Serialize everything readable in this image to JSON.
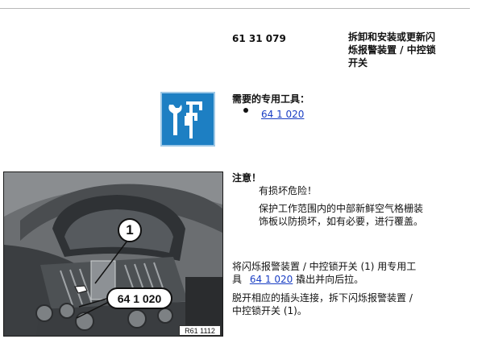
{
  "header": {
    "repair_number": "61 31 079",
    "title_lines": [
      "拆卸和安装或更新闪",
      "烁报警装置 / 中控锁",
      "开关"
    ]
  },
  "tools": {
    "heading": "需要的专用工具：",
    "items": [
      {
        "code": "64 1 020"
      }
    ],
    "icon": "tools-icon"
  },
  "notice": {
    "heading": "注意！",
    "warning": "有损坏危险！",
    "body_lines": [
      "保护工作范围内的中部新鲜空气格栅装",
      "饰板以防损坏，如有必要，进行覆盖。"
    ]
  },
  "step1": {
    "line1": "将闪烁报警装置 / 中控锁开关 (1) 用专用工",
    "line2_prefix": "具",
    "tool_link": "64 1 020",
    "line2_suffix": "撬出并向后拉。"
  },
  "step2": {
    "line1": "脱开相应的插头连接，拆下闪烁报警装置 /",
    "line2": "中控锁开关 (1)。"
  },
  "figure": {
    "callout_part": "1",
    "callout_tool": "64 1 020",
    "image_ref": "R61 1112"
  }
}
